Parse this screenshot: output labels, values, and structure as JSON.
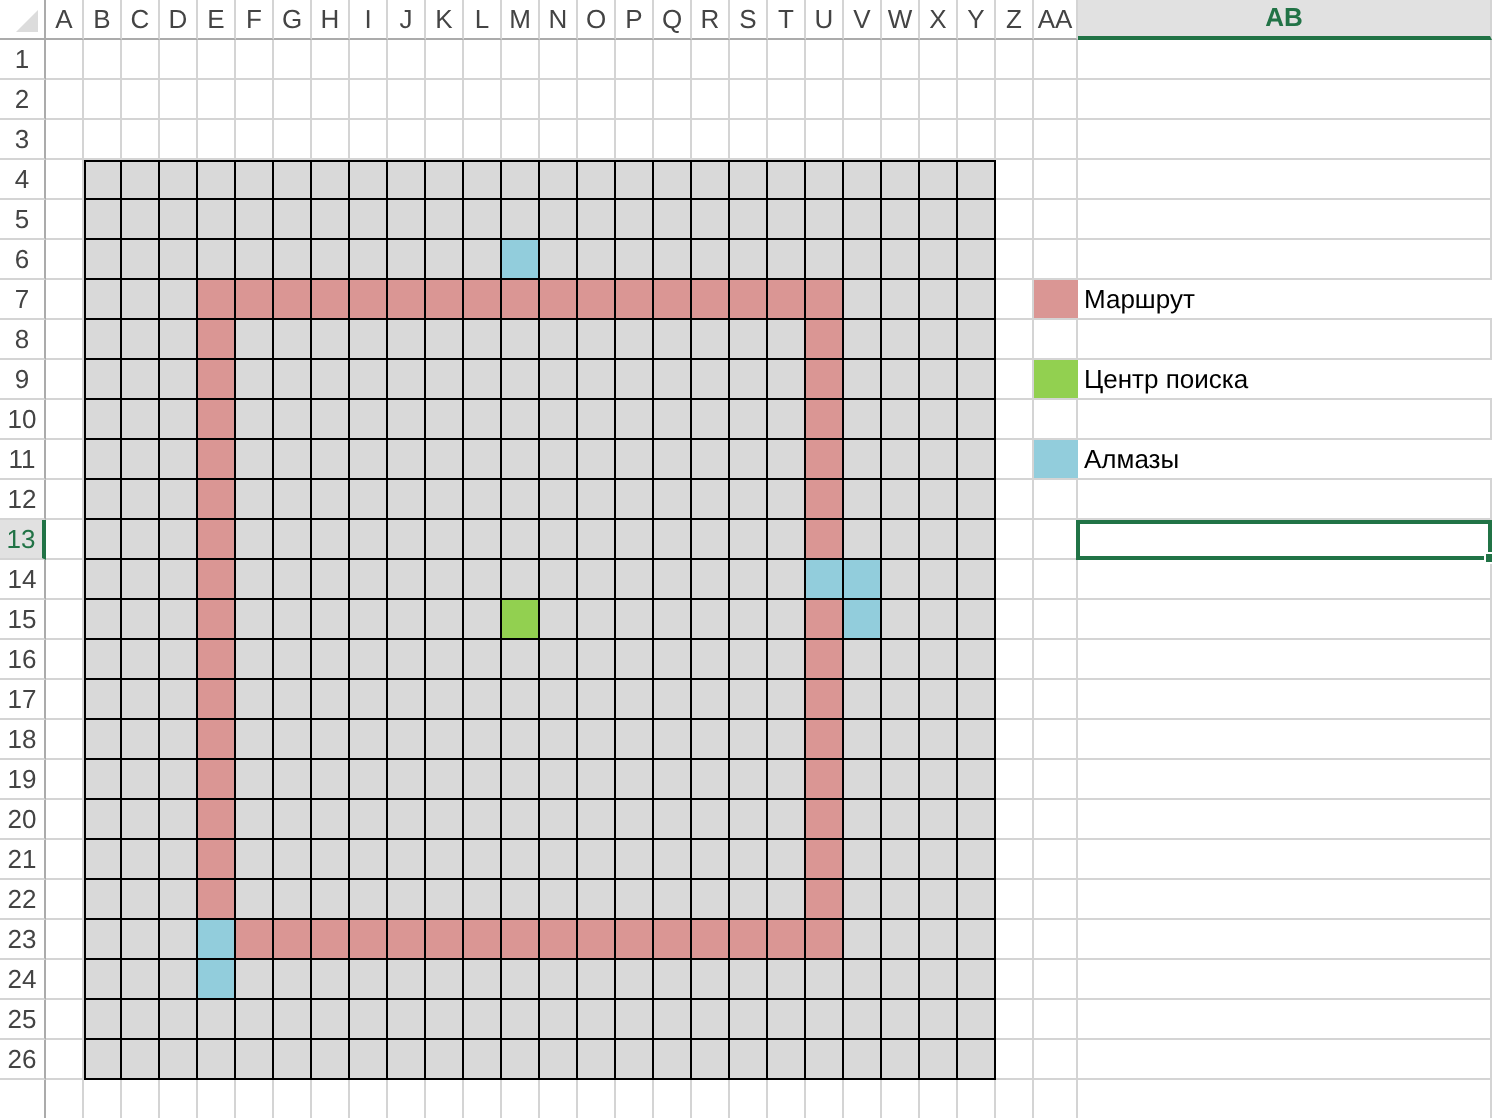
{
  "columns": [
    {
      "label": "A",
      "selected": false
    },
    {
      "label": "B",
      "selected": false
    },
    {
      "label": "C",
      "selected": false
    },
    {
      "label": "D",
      "selected": false
    },
    {
      "label": "E",
      "selected": false
    },
    {
      "label": "F",
      "selected": false
    },
    {
      "label": "G",
      "selected": false
    },
    {
      "label": "H",
      "selected": false
    },
    {
      "label": "I",
      "selected": false
    },
    {
      "label": "J",
      "selected": false
    },
    {
      "label": "K",
      "selected": false
    },
    {
      "label": "L",
      "selected": false
    },
    {
      "label": "M",
      "selected": false
    },
    {
      "label": "N",
      "selected": false
    },
    {
      "label": "O",
      "selected": false
    },
    {
      "label": "P",
      "selected": false
    },
    {
      "label": "Q",
      "selected": false
    },
    {
      "label": "R",
      "selected": false
    },
    {
      "label": "S",
      "selected": false
    },
    {
      "label": "T",
      "selected": false
    },
    {
      "label": "U",
      "selected": false
    },
    {
      "label": "V",
      "selected": false
    },
    {
      "label": "W",
      "selected": false
    },
    {
      "label": "X",
      "selected": false
    },
    {
      "label": "Y",
      "selected": false
    },
    {
      "label": "Z",
      "selected": false
    },
    {
      "label": "AA",
      "selected": false
    },
    {
      "label": "AB",
      "selected": true
    }
  ],
  "rows": [
    {
      "label": "1",
      "selected": false
    },
    {
      "label": "2",
      "selected": false
    },
    {
      "label": "3",
      "selected": false
    },
    {
      "label": "4",
      "selected": false
    },
    {
      "label": "5",
      "selected": false
    },
    {
      "label": "6",
      "selected": false
    },
    {
      "label": "7",
      "selected": false
    },
    {
      "label": "8",
      "selected": false
    },
    {
      "label": "9",
      "selected": false
    },
    {
      "label": "10",
      "selected": false
    },
    {
      "label": "11",
      "selected": false
    },
    {
      "label": "12",
      "selected": false
    },
    {
      "label": "13",
      "selected": true
    },
    {
      "label": "14",
      "selected": false
    },
    {
      "label": "15",
      "selected": false
    },
    {
      "label": "16",
      "selected": false
    },
    {
      "label": "17",
      "selected": false
    },
    {
      "label": "18",
      "selected": false
    },
    {
      "label": "19",
      "selected": false
    },
    {
      "label": "20",
      "selected": false
    },
    {
      "label": "21",
      "selected": false
    },
    {
      "label": "22",
      "selected": false
    },
    {
      "label": "23",
      "selected": false
    },
    {
      "label": "24",
      "selected": false
    },
    {
      "label": "25",
      "selected": false
    },
    {
      "label": "26",
      "selected": false
    }
  ],
  "legend": [
    {
      "kind": "route",
      "color": "#da9694",
      "label": "Маршрут"
    },
    {
      "kind": "center",
      "color": "#92d050",
      "label": "Центр поиска"
    },
    {
      "kind": "diamond",
      "color": "#92cddc",
      "label": "Алмазы"
    }
  ],
  "grid": [
    {
      "cells": [
        {
          "kind": "empty"
        },
        {
          "kind": "empty"
        },
        {
          "kind": "empty"
        },
        {
          "kind": "empty"
        },
        {
          "kind": "empty"
        },
        {
          "kind": "empty"
        },
        {
          "kind": "empty"
        },
        {
          "kind": "empty"
        },
        {
          "kind": "empty"
        },
        {
          "kind": "empty"
        },
        {
          "kind": "empty"
        },
        {
          "kind": "empty"
        },
        {
          "kind": "empty"
        },
        {
          "kind": "empty"
        },
        {
          "kind": "empty"
        },
        {
          "kind": "empty"
        },
        {
          "kind": "empty"
        },
        {
          "kind": "empty"
        },
        {
          "kind": "empty"
        },
        {
          "kind": "empty"
        },
        {
          "kind": "empty"
        },
        {
          "kind": "empty"
        },
        {
          "kind": "empty"
        },
        {
          "kind": "empty"
        }
      ]
    },
    {
      "cells": [
        {
          "kind": "empty"
        },
        {
          "kind": "empty"
        },
        {
          "kind": "empty"
        },
        {
          "kind": "empty"
        },
        {
          "kind": "empty"
        },
        {
          "kind": "empty"
        },
        {
          "kind": "empty"
        },
        {
          "kind": "empty"
        },
        {
          "kind": "empty"
        },
        {
          "kind": "empty"
        },
        {
          "kind": "empty"
        },
        {
          "kind": "empty"
        },
        {
          "kind": "empty"
        },
        {
          "kind": "empty"
        },
        {
          "kind": "empty"
        },
        {
          "kind": "empty"
        },
        {
          "kind": "empty"
        },
        {
          "kind": "empty"
        },
        {
          "kind": "empty"
        },
        {
          "kind": "empty"
        },
        {
          "kind": "empty"
        },
        {
          "kind": "empty"
        },
        {
          "kind": "empty"
        },
        {
          "kind": "empty"
        }
      ]
    },
    {
      "cells": [
        {
          "kind": "empty"
        },
        {
          "kind": "empty"
        },
        {
          "kind": "empty"
        },
        {
          "kind": "empty"
        },
        {
          "kind": "empty"
        },
        {
          "kind": "empty"
        },
        {
          "kind": "empty"
        },
        {
          "kind": "empty"
        },
        {
          "kind": "empty"
        },
        {
          "kind": "empty"
        },
        {
          "kind": "empty"
        },
        {
          "kind": "diamond"
        },
        {
          "kind": "empty"
        },
        {
          "kind": "empty"
        },
        {
          "kind": "empty"
        },
        {
          "kind": "empty"
        },
        {
          "kind": "empty"
        },
        {
          "kind": "empty"
        },
        {
          "kind": "empty"
        },
        {
          "kind": "empty"
        },
        {
          "kind": "empty"
        },
        {
          "kind": "empty"
        },
        {
          "kind": "empty"
        },
        {
          "kind": "empty"
        }
      ]
    },
    {
      "cells": [
        {
          "kind": "empty"
        },
        {
          "kind": "empty"
        },
        {
          "kind": "empty"
        },
        {
          "kind": "route"
        },
        {
          "kind": "route"
        },
        {
          "kind": "route"
        },
        {
          "kind": "route"
        },
        {
          "kind": "route"
        },
        {
          "kind": "route"
        },
        {
          "kind": "route"
        },
        {
          "kind": "route"
        },
        {
          "kind": "route"
        },
        {
          "kind": "route"
        },
        {
          "kind": "route"
        },
        {
          "kind": "route"
        },
        {
          "kind": "route"
        },
        {
          "kind": "route"
        },
        {
          "kind": "route"
        },
        {
          "kind": "route"
        },
        {
          "kind": "route"
        },
        {
          "kind": "empty"
        },
        {
          "kind": "empty"
        },
        {
          "kind": "empty"
        },
        {
          "kind": "empty"
        }
      ]
    },
    {
      "cells": [
        {
          "kind": "empty"
        },
        {
          "kind": "empty"
        },
        {
          "kind": "empty"
        },
        {
          "kind": "route"
        },
        {
          "kind": "empty"
        },
        {
          "kind": "empty"
        },
        {
          "kind": "empty"
        },
        {
          "kind": "empty"
        },
        {
          "kind": "empty"
        },
        {
          "kind": "empty"
        },
        {
          "kind": "empty"
        },
        {
          "kind": "empty"
        },
        {
          "kind": "empty"
        },
        {
          "kind": "empty"
        },
        {
          "kind": "empty"
        },
        {
          "kind": "empty"
        },
        {
          "kind": "empty"
        },
        {
          "kind": "empty"
        },
        {
          "kind": "empty"
        },
        {
          "kind": "route"
        },
        {
          "kind": "empty"
        },
        {
          "kind": "empty"
        },
        {
          "kind": "empty"
        },
        {
          "kind": "empty"
        }
      ]
    },
    {
      "cells": [
        {
          "kind": "empty"
        },
        {
          "kind": "empty"
        },
        {
          "kind": "empty"
        },
        {
          "kind": "route"
        },
        {
          "kind": "empty"
        },
        {
          "kind": "empty"
        },
        {
          "kind": "empty"
        },
        {
          "kind": "empty"
        },
        {
          "kind": "empty"
        },
        {
          "kind": "empty"
        },
        {
          "kind": "empty"
        },
        {
          "kind": "empty"
        },
        {
          "kind": "empty"
        },
        {
          "kind": "empty"
        },
        {
          "kind": "empty"
        },
        {
          "kind": "empty"
        },
        {
          "kind": "empty"
        },
        {
          "kind": "empty"
        },
        {
          "kind": "empty"
        },
        {
          "kind": "route"
        },
        {
          "kind": "empty"
        },
        {
          "kind": "empty"
        },
        {
          "kind": "empty"
        },
        {
          "kind": "empty"
        }
      ]
    },
    {
      "cells": [
        {
          "kind": "empty"
        },
        {
          "kind": "empty"
        },
        {
          "kind": "empty"
        },
        {
          "kind": "route"
        },
        {
          "kind": "empty"
        },
        {
          "kind": "empty"
        },
        {
          "kind": "empty"
        },
        {
          "kind": "empty"
        },
        {
          "kind": "empty"
        },
        {
          "kind": "empty"
        },
        {
          "kind": "empty"
        },
        {
          "kind": "empty"
        },
        {
          "kind": "empty"
        },
        {
          "kind": "empty"
        },
        {
          "kind": "empty"
        },
        {
          "kind": "empty"
        },
        {
          "kind": "empty"
        },
        {
          "kind": "empty"
        },
        {
          "kind": "empty"
        },
        {
          "kind": "route"
        },
        {
          "kind": "empty"
        },
        {
          "kind": "empty"
        },
        {
          "kind": "empty"
        },
        {
          "kind": "empty"
        }
      ]
    },
    {
      "cells": [
        {
          "kind": "empty"
        },
        {
          "kind": "empty"
        },
        {
          "kind": "empty"
        },
        {
          "kind": "route"
        },
        {
          "kind": "empty"
        },
        {
          "kind": "empty"
        },
        {
          "kind": "empty"
        },
        {
          "kind": "empty"
        },
        {
          "kind": "empty"
        },
        {
          "kind": "empty"
        },
        {
          "kind": "empty"
        },
        {
          "kind": "empty"
        },
        {
          "kind": "empty"
        },
        {
          "kind": "empty"
        },
        {
          "kind": "empty"
        },
        {
          "kind": "empty"
        },
        {
          "kind": "empty"
        },
        {
          "kind": "empty"
        },
        {
          "kind": "empty"
        },
        {
          "kind": "route"
        },
        {
          "kind": "empty"
        },
        {
          "kind": "empty"
        },
        {
          "kind": "empty"
        },
        {
          "kind": "empty"
        }
      ]
    },
    {
      "cells": [
        {
          "kind": "empty"
        },
        {
          "kind": "empty"
        },
        {
          "kind": "empty"
        },
        {
          "kind": "route"
        },
        {
          "kind": "empty"
        },
        {
          "kind": "empty"
        },
        {
          "kind": "empty"
        },
        {
          "kind": "empty"
        },
        {
          "kind": "empty"
        },
        {
          "kind": "empty"
        },
        {
          "kind": "empty"
        },
        {
          "kind": "empty"
        },
        {
          "kind": "empty"
        },
        {
          "kind": "empty"
        },
        {
          "kind": "empty"
        },
        {
          "kind": "empty"
        },
        {
          "kind": "empty"
        },
        {
          "kind": "empty"
        },
        {
          "kind": "empty"
        },
        {
          "kind": "route"
        },
        {
          "kind": "empty"
        },
        {
          "kind": "empty"
        },
        {
          "kind": "empty"
        },
        {
          "kind": "empty"
        }
      ]
    },
    {
      "cells": [
        {
          "kind": "empty"
        },
        {
          "kind": "empty"
        },
        {
          "kind": "empty"
        },
        {
          "kind": "route"
        },
        {
          "kind": "empty"
        },
        {
          "kind": "empty"
        },
        {
          "kind": "empty"
        },
        {
          "kind": "empty"
        },
        {
          "kind": "empty"
        },
        {
          "kind": "empty"
        },
        {
          "kind": "empty"
        },
        {
          "kind": "empty"
        },
        {
          "kind": "empty"
        },
        {
          "kind": "empty"
        },
        {
          "kind": "empty"
        },
        {
          "kind": "empty"
        },
        {
          "kind": "empty"
        },
        {
          "kind": "empty"
        },
        {
          "kind": "empty"
        },
        {
          "kind": "route"
        },
        {
          "kind": "empty"
        },
        {
          "kind": "empty"
        },
        {
          "kind": "empty"
        },
        {
          "kind": "empty"
        }
      ]
    },
    {
      "cells": [
        {
          "kind": "empty"
        },
        {
          "kind": "empty"
        },
        {
          "kind": "empty"
        },
        {
          "kind": "route"
        },
        {
          "kind": "empty"
        },
        {
          "kind": "empty"
        },
        {
          "kind": "empty"
        },
        {
          "kind": "empty"
        },
        {
          "kind": "empty"
        },
        {
          "kind": "empty"
        },
        {
          "kind": "empty"
        },
        {
          "kind": "empty"
        },
        {
          "kind": "empty"
        },
        {
          "kind": "empty"
        },
        {
          "kind": "empty"
        },
        {
          "kind": "empty"
        },
        {
          "kind": "empty"
        },
        {
          "kind": "empty"
        },
        {
          "kind": "empty"
        },
        {
          "kind": "diamond"
        },
        {
          "kind": "diamond"
        },
        {
          "kind": "empty"
        },
        {
          "kind": "empty"
        },
        {
          "kind": "empty"
        }
      ]
    },
    {
      "cells": [
        {
          "kind": "empty"
        },
        {
          "kind": "empty"
        },
        {
          "kind": "empty"
        },
        {
          "kind": "route"
        },
        {
          "kind": "empty"
        },
        {
          "kind": "empty"
        },
        {
          "kind": "empty"
        },
        {
          "kind": "empty"
        },
        {
          "kind": "empty"
        },
        {
          "kind": "empty"
        },
        {
          "kind": "empty"
        },
        {
          "kind": "center"
        },
        {
          "kind": "empty"
        },
        {
          "kind": "empty"
        },
        {
          "kind": "empty"
        },
        {
          "kind": "empty"
        },
        {
          "kind": "empty"
        },
        {
          "kind": "empty"
        },
        {
          "kind": "empty"
        },
        {
          "kind": "route"
        },
        {
          "kind": "diamond"
        },
        {
          "kind": "empty"
        },
        {
          "kind": "empty"
        },
        {
          "kind": "empty"
        }
      ]
    },
    {
      "cells": [
        {
          "kind": "empty"
        },
        {
          "kind": "empty"
        },
        {
          "kind": "empty"
        },
        {
          "kind": "route"
        },
        {
          "kind": "empty"
        },
        {
          "kind": "empty"
        },
        {
          "kind": "empty"
        },
        {
          "kind": "empty"
        },
        {
          "kind": "empty"
        },
        {
          "kind": "empty"
        },
        {
          "kind": "empty"
        },
        {
          "kind": "empty"
        },
        {
          "kind": "empty"
        },
        {
          "kind": "empty"
        },
        {
          "kind": "empty"
        },
        {
          "kind": "empty"
        },
        {
          "kind": "empty"
        },
        {
          "kind": "empty"
        },
        {
          "kind": "empty"
        },
        {
          "kind": "route"
        },
        {
          "kind": "empty"
        },
        {
          "kind": "empty"
        },
        {
          "kind": "empty"
        },
        {
          "kind": "empty"
        }
      ]
    },
    {
      "cells": [
        {
          "kind": "empty"
        },
        {
          "kind": "empty"
        },
        {
          "kind": "empty"
        },
        {
          "kind": "route"
        },
        {
          "kind": "empty"
        },
        {
          "kind": "empty"
        },
        {
          "kind": "empty"
        },
        {
          "kind": "empty"
        },
        {
          "kind": "empty"
        },
        {
          "kind": "empty"
        },
        {
          "kind": "empty"
        },
        {
          "kind": "empty"
        },
        {
          "kind": "empty"
        },
        {
          "kind": "empty"
        },
        {
          "kind": "empty"
        },
        {
          "kind": "empty"
        },
        {
          "kind": "empty"
        },
        {
          "kind": "empty"
        },
        {
          "kind": "empty"
        },
        {
          "kind": "route"
        },
        {
          "kind": "empty"
        },
        {
          "kind": "empty"
        },
        {
          "kind": "empty"
        },
        {
          "kind": "empty"
        }
      ]
    },
    {
      "cells": [
        {
          "kind": "empty"
        },
        {
          "kind": "empty"
        },
        {
          "kind": "empty"
        },
        {
          "kind": "route"
        },
        {
          "kind": "empty"
        },
        {
          "kind": "empty"
        },
        {
          "kind": "empty"
        },
        {
          "kind": "empty"
        },
        {
          "kind": "empty"
        },
        {
          "kind": "empty"
        },
        {
          "kind": "empty"
        },
        {
          "kind": "empty"
        },
        {
          "kind": "empty"
        },
        {
          "kind": "empty"
        },
        {
          "kind": "empty"
        },
        {
          "kind": "empty"
        },
        {
          "kind": "empty"
        },
        {
          "kind": "empty"
        },
        {
          "kind": "empty"
        },
        {
          "kind": "route"
        },
        {
          "kind": "empty"
        },
        {
          "kind": "empty"
        },
        {
          "kind": "empty"
        },
        {
          "kind": "empty"
        }
      ]
    },
    {
      "cells": [
        {
          "kind": "empty"
        },
        {
          "kind": "empty"
        },
        {
          "kind": "empty"
        },
        {
          "kind": "route"
        },
        {
          "kind": "empty"
        },
        {
          "kind": "empty"
        },
        {
          "kind": "empty"
        },
        {
          "kind": "empty"
        },
        {
          "kind": "empty"
        },
        {
          "kind": "empty"
        },
        {
          "kind": "empty"
        },
        {
          "kind": "empty"
        },
        {
          "kind": "empty"
        },
        {
          "kind": "empty"
        },
        {
          "kind": "empty"
        },
        {
          "kind": "empty"
        },
        {
          "kind": "empty"
        },
        {
          "kind": "empty"
        },
        {
          "kind": "empty"
        },
        {
          "kind": "route"
        },
        {
          "kind": "empty"
        },
        {
          "kind": "empty"
        },
        {
          "kind": "empty"
        },
        {
          "kind": "empty"
        }
      ]
    },
    {
      "cells": [
        {
          "kind": "empty"
        },
        {
          "kind": "empty"
        },
        {
          "kind": "empty"
        },
        {
          "kind": "route"
        },
        {
          "kind": "empty"
        },
        {
          "kind": "empty"
        },
        {
          "kind": "empty"
        },
        {
          "kind": "empty"
        },
        {
          "kind": "empty"
        },
        {
          "kind": "empty"
        },
        {
          "kind": "empty"
        },
        {
          "kind": "empty"
        },
        {
          "kind": "empty"
        },
        {
          "kind": "empty"
        },
        {
          "kind": "empty"
        },
        {
          "kind": "empty"
        },
        {
          "kind": "empty"
        },
        {
          "kind": "empty"
        },
        {
          "kind": "empty"
        },
        {
          "kind": "route"
        },
        {
          "kind": "empty"
        },
        {
          "kind": "empty"
        },
        {
          "kind": "empty"
        },
        {
          "kind": "empty"
        }
      ]
    },
    {
      "cells": [
        {
          "kind": "empty"
        },
        {
          "kind": "empty"
        },
        {
          "kind": "empty"
        },
        {
          "kind": "route"
        },
        {
          "kind": "empty"
        },
        {
          "kind": "empty"
        },
        {
          "kind": "empty"
        },
        {
          "kind": "empty"
        },
        {
          "kind": "empty"
        },
        {
          "kind": "empty"
        },
        {
          "kind": "empty"
        },
        {
          "kind": "empty"
        },
        {
          "kind": "empty"
        },
        {
          "kind": "empty"
        },
        {
          "kind": "empty"
        },
        {
          "kind": "empty"
        },
        {
          "kind": "empty"
        },
        {
          "kind": "empty"
        },
        {
          "kind": "empty"
        },
        {
          "kind": "route"
        },
        {
          "kind": "empty"
        },
        {
          "kind": "empty"
        },
        {
          "kind": "empty"
        },
        {
          "kind": "empty"
        }
      ]
    },
    {
      "cells": [
        {
          "kind": "empty"
        },
        {
          "kind": "empty"
        },
        {
          "kind": "empty"
        },
        {
          "kind": "route"
        },
        {
          "kind": "empty"
        },
        {
          "kind": "empty"
        },
        {
          "kind": "empty"
        },
        {
          "kind": "empty"
        },
        {
          "kind": "empty"
        },
        {
          "kind": "empty"
        },
        {
          "kind": "empty"
        },
        {
          "kind": "empty"
        },
        {
          "kind": "empty"
        },
        {
          "kind": "empty"
        },
        {
          "kind": "empty"
        },
        {
          "kind": "empty"
        },
        {
          "kind": "empty"
        },
        {
          "kind": "empty"
        },
        {
          "kind": "empty"
        },
        {
          "kind": "route"
        },
        {
          "kind": "empty"
        },
        {
          "kind": "empty"
        },
        {
          "kind": "empty"
        },
        {
          "kind": "empty"
        }
      ]
    },
    {
      "cells": [
        {
          "kind": "empty"
        },
        {
          "kind": "empty"
        },
        {
          "kind": "empty"
        },
        {
          "kind": "diamond"
        },
        {
          "kind": "route"
        },
        {
          "kind": "route"
        },
        {
          "kind": "route"
        },
        {
          "kind": "route"
        },
        {
          "kind": "route"
        },
        {
          "kind": "route"
        },
        {
          "kind": "route"
        },
        {
          "kind": "route"
        },
        {
          "kind": "route"
        },
        {
          "kind": "route"
        },
        {
          "kind": "route"
        },
        {
          "kind": "route"
        },
        {
          "kind": "route"
        },
        {
          "kind": "route"
        },
        {
          "kind": "route"
        },
        {
          "kind": "route"
        },
        {
          "kind": "empty"
        },
        {
          "kind": "empty"
        },
        {
          "kind": "empty"
        },
        {
          "kind": "empty"
        }
      ]
    },
    {
      "cells": [
        {
          "kind": "empty"
        },
        {
          "kind": "empty"
        },
        {
          "kind": "empty"
        },
        {
          "kind": "diamond"
        },
        {
          "kind": "empty"
        },
        {
          "kind": "empty"
        },
        {
          "kind": "empty"
        },
        {
          "kind": "empty"
        },
        {
          "kind": "empty"
        },
        {
          "kind": "empty"
        },
        {
          "kind": "empty"
        },
        {
          "kind": "empty"
        },
        {
          "kind": "empty"
        },
        {
          "kind": "empty"
        },
        {
          "kind": "empty"
        },
        {
          "kind": "empty"
        },
        {
          "kind": "empty"
        },
        {
          "kind": "empty"
        },
        {
          "kind": "empty"
        },
        {
          "kind": "empty"
        },
        {
          "kind": "empty"
        },
        {
          "kind": "empty"
        },
        {
          "kind": "empty"
        },
        {
          "kind": "empty"
        }
      ]
    },
    {
      "cells": [
        {
          "kind": "empty"
        },
        {
          "kind": "empty"
        },
        {
          "kind": "empty"
        },
        {
          "kind": "empty"
        },
        {
          "kind": "empty"
        },
        {
          "kind": "empty"
        },
        {
          "kind": "empty"
        },
        {
          "kind": "empty"
        },
        {
          "kind": "empty"
        },
        {
          "kind": "empty"
        },
        {
          "kind": "empty"
        },
        {
          "kind": "empty"
        },
        {
          "kind": "empty"
        },
        {
          "kind": "empty"
        },
        {
          "kind": "empty"
        },
        {
          "kind": "empty"
        },
        {
          "kind": "empty"
        },
        {
          "kind": "empty"
        },
        {
          "kind": "empty"
        },
        {
          "kind": "empty"
        },
        {
          "kind": "empty"
        },
        {
          "kind": "empty"
        },
        {
          "kind": "empty"
        },
        {
          "kind": "empty"
        }
      ]
    },
    {
      "cells": [
        {
          "kind": "empty"
        },
        {
          "kind": "empty"
        },
        {
          "kind": "empty"
        },
        {
          "kind": "empty"
        },
        {
          "kind": "empty"
        },
        {
          "kind": "empty"
        },
        {
          "kind": "empty"
        },
        {
          "kind": "empty"
        },
        {
          "kind": "empty"
        },
        {
          "kind": "empty"
        },
        {
          "kind": "empty"
        },
        {
          "kind": "empty"
        },
        {
          "kind": "empty"
        },
        {
          "kind": "empty"
        },
        {
          "kind": "empty"
        },
        {
          "kind": "empty"
        },
        {
          "kind": "empty"
        },
        {
          "kind": "empty"
        },
        {
          "kind": "empty"
        },
        {
          "kind": "empty"
        },
        {
          "kind": "empty"
        },
        {
          "kind": "empty"
        },
        {
          "kind": "empty"
        },
        {
          "kind": "empty"
        }
      ]
    }
  ]
}
